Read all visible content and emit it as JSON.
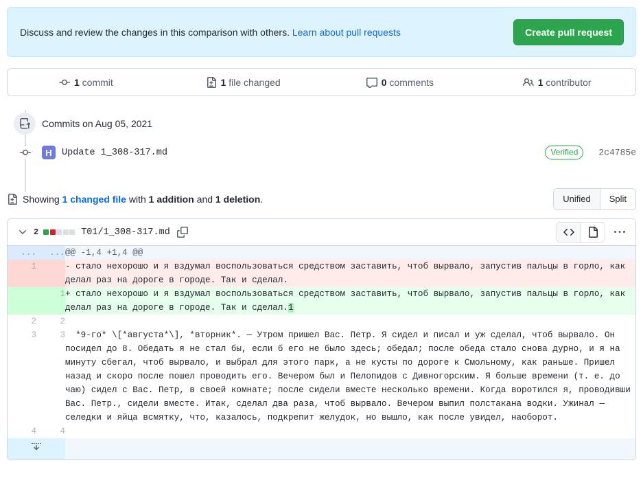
{
  "banner": {
    "text_before": "Discuss and review the changes in this comparison with others. ",
    "link_label": "Learn about pull requests",
    "create_button": "Create pull request"
  },
  "stats": [
    {
      "icon": "commit-icon",
      "count": "1",
      "label": " commit",
      "name": "stat-commits"
    },
    {
      "icon": "file-diff-icon",
      "count": "1",
      "label": " file changed",
      "name": "stat-files-changed"
    },
    {
      "icon": "comment-icon",
      "count": "0",
      "label": " comments",
      "name": "stat-comments"
    },
    {
      "icon": "people-icon",
      "count": "1",
      "label": " contributor",
      "name": "stat-contributors"
    }
  ],
  "commits": {
    "group_label": "Commits on Aug 05, 2021",
    "items": [
      {
        "message": "Update 1_308-317.md",
        "verified_badge": "Verified",
        "sha": "2c4785e",
        "avatar_glyph": "H"
      }
    ]
  },
  "showing": {
    "prefix": "Showing ",
    "changed_file_link": "1 changed file",
    "middle": " with ",
    "additions": "1 addition",
    "conjunction": " and ",
    "deletions": "1 deletion",
    "suffix": ".",
    "diff_modes": [
      {
        "label": "Unified",
        "selected": true
      },
      {
        "label": "Split",
        "selected": false
      }
    ]
  },
  "file": {
    "change_count": "2",
    "stat_squares": [
      "add",
      "del",
      "neutral",
      "neutral",
      "neutral"
    ],
    "path": "T01/1_308-317.md",
    "actions": {
      "view_code_icon": "code-icon",
      "view_file_icon": "file-icon",
      "menu_icon": "kebab-horizontal-icon"
    }
  },
  "diff": {
    "rows": [
      {
        "type": "hunk",
        "old_num": "...",
        "new_num": "...",
        "text": "@@ -1,4 +1,4 @@"
      },
      {
        "type": "del",
        "old_num": "1",
        "new_num": "",
        "text": "- стало нехорошо и я вздумал воспользоваться средством заставить, чтоб вырвало, запустив пальцы в горло, как делал раз на дороге в городе. Так и сделал."
      },
      {
        "type": "add",
        "old_num": "",
        "new_num": "1",
        "text_before": "+ стало нехорошо и я вздумал воспользоваться средством заставить, чтоб вырвало, запустив пальцы в горло, как делал раз на дороге в городе. Так и сделал.",
        "highlight": "1",
        "text_after": ""
      },
      {
        "type": "ctx",
        "old_num": "2",
        "new_num": "2",
        "text": ""
      },
      {
        "type": "ctx",
        "old_num": "3",
        "new_num": "3",
        "text": "  *9-го* \\[*августа*\\], *вторник*. — Утром пришел Вас. Петр. Я сидел и писал и уж сделал, чтоб вырвало. Он посидел до 8. Обедать я не стал бы, если б его не было здесь; обедал; после обеда стало снова дурно, и я на минуту сбегал, чтоб вырвало, и выбрал для этого парк, а не кусты по дороге к Смольному, как раньше. Пришел назад и скоро после пошел проводить его. Вечером был и Пелопидов с Дивногорским. Я больше времени (т. е. до чаю) сидел с Вас. Петр, в своей комнате; после сидели вместе несколько времени. Когда воротился я, проводивши Вас. Петр., сидели вместе. Итак, сделал два раза, чтоб вырвало. Вечером выпил полстакана водки. Ужинал — селедки и яйца всмятку, что, казалось, подкрепит желудок, но вышло, как после увидел, наоборот."
      },
      {
        "type": "ctx",
        "old_num": "4",
        "new_num": "4",
        "text": ""
      },
      {
        "type": "expander",
        "old_num": "",
        "new_num": "",
        "text": ""
      }
    ]
  }
}
